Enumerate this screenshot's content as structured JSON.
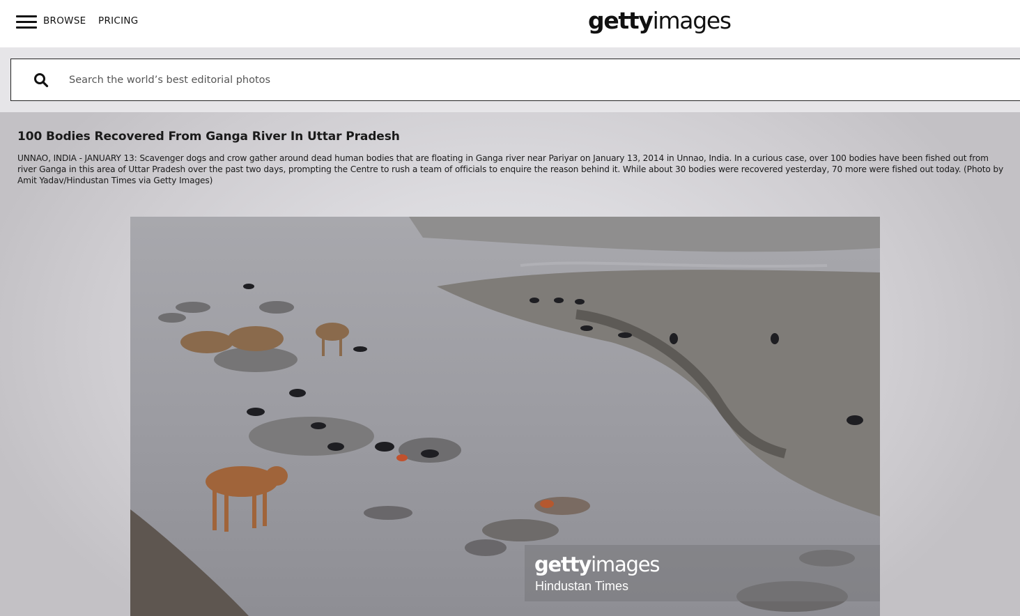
{
  "header": {
    "nav": {
      "browse": "BROWSE",
      "pricing": "PRICING"
    },
    "logo": {
      "bold": "getty",
      "light": "images"
    }
  },
  "search": {
    "placeholder": "Search the world’s best editorial photos"
  },
  "image": {
    "title": "100 Bodies Recovered From Ganga River In Uttar Pradesh",
    "caption": "UNNAO, INDIA - JANUARY 13: Scavenger dogs and crow gather around dead human bodies that are floating in Ganga river near Pariyar on January 13, 2014 in Unnao, India. In a curious case, over 100 bodies have been fished out from river Ganga in this area of Uttar Pradesh over the past two days, prompting the Centre to rush a team of officials to enquire the reason behind it. While about 30 bodies were recovered yesterday, 70 more were fished out today. (Photo by Amit Yadav/Hindustan Times via Getty Images)",
    "watermark": {
      "logo_bold": "getty",
      "logo_light": "images",
      "credit": "Hindustan Times"
    }
  },
  "icons": {
    "menu": "hamburger-menu-icon",
    "search": "search-icon"
  },
  "colors": {
    "header_bg": "#ffffff",
    "search_band": "#e6e5e8",
    "text": "#111111"
  }
}
